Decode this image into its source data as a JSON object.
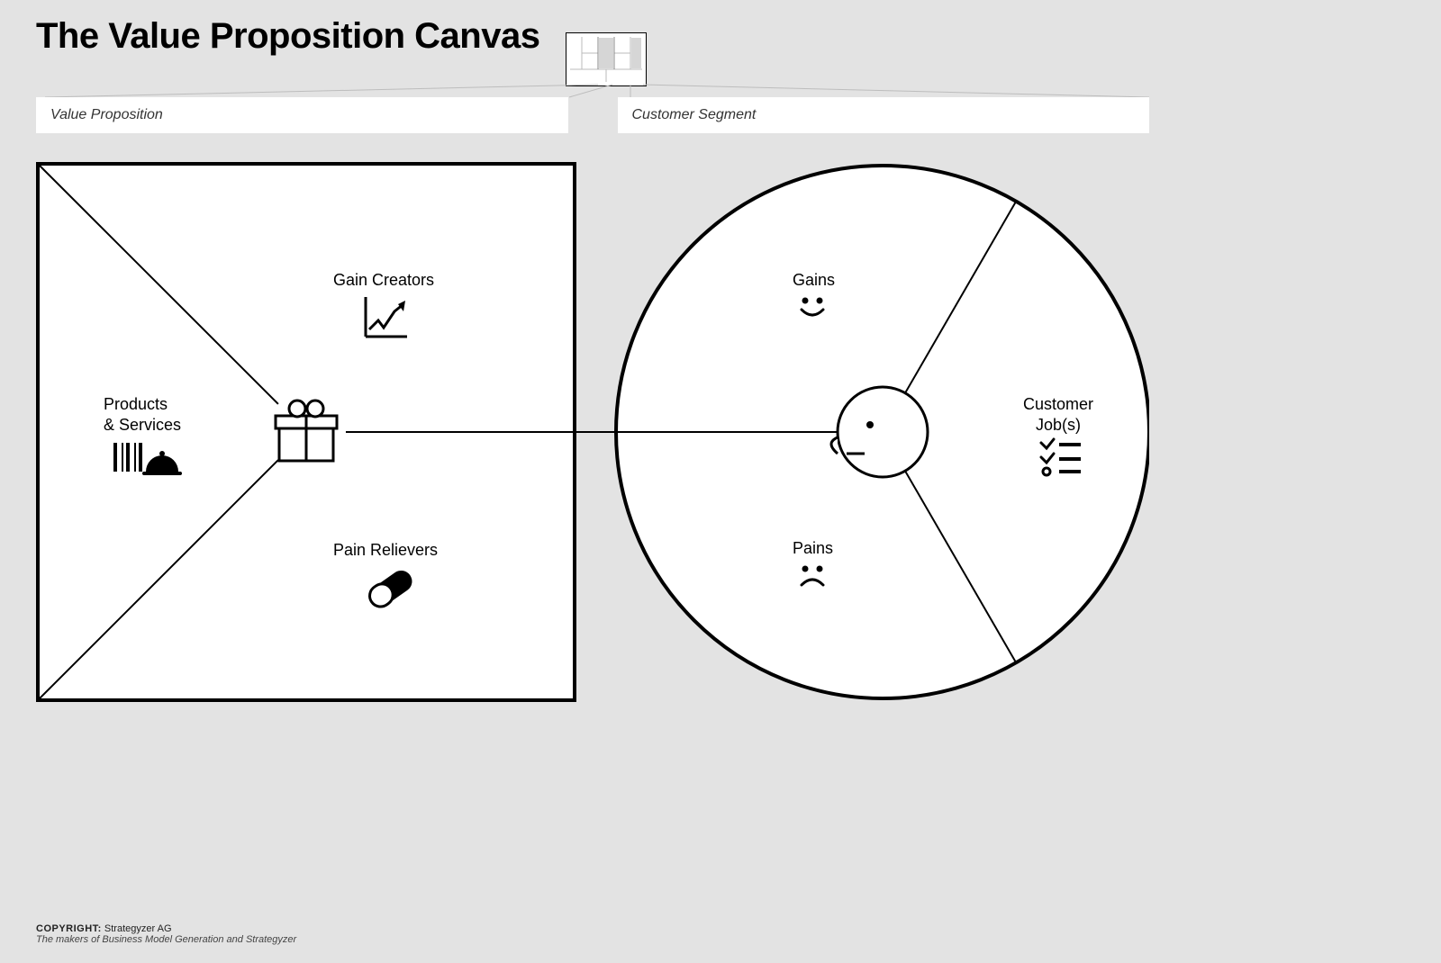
{
  "title": "The Value Proposition Canvas",
  "tabs": {
    "left": "Value Proposition",
    "right": "Customer Segment"
  },
  "value_map": {
    "products_services": "Products\n& Services",
    "gain_creators": "Gain Creators",
    "pain_relievers": "Pain Relievers"
  },
  "customer_profile": {
    "gains": "Gains",
    "pains": "Pains",
    "customer_jobs": "Customer\nJob(s)"
  },
  "footer": {
    "copyright_label": "COPYRIGHT:",
    "copyright_holder": "Strategyzer AG",
    "tagline": "The makers of Business Model Generation and Strategyzer"
  }
}
